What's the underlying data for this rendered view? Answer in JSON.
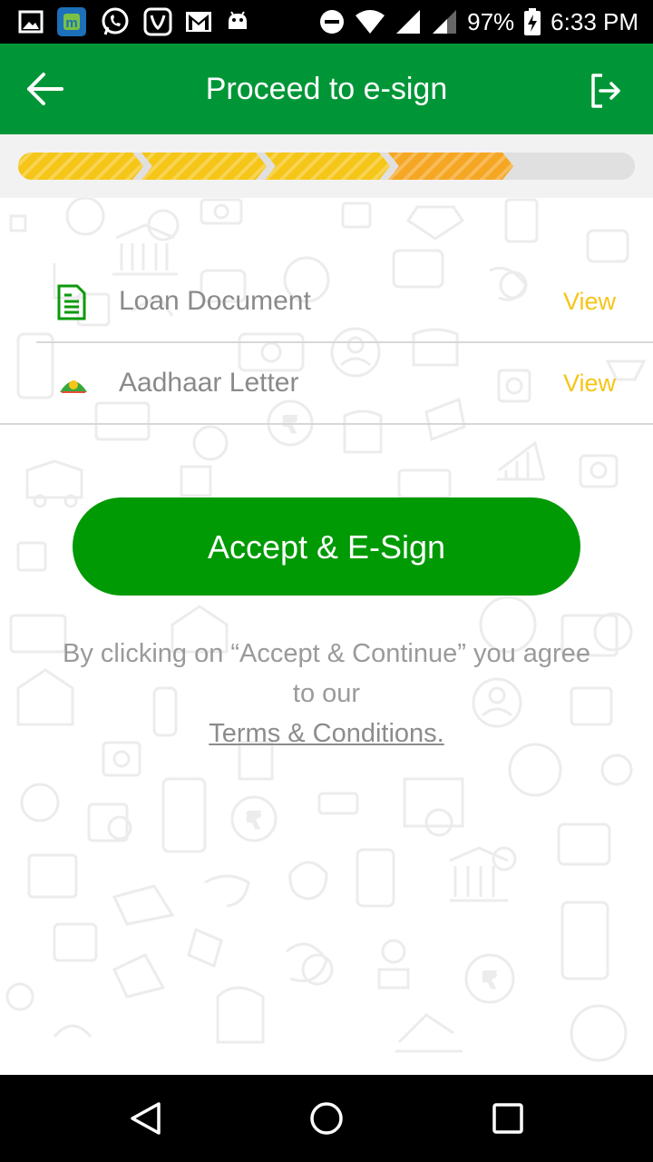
{
  "status_bar": {
    "battery": "97%",
    "time": "6:33 PM"
  },
  "app_bar": {
    "title": "Proceed to e-sign",
    "background": "#009637"
  },
  "progress": {
    "completed_steps": 4,
    "total_steps": 5
  },
  "documents": [
    {
      "label": "Loan Document",
      "action": "View",
      "icon": "document-icon"
    },
    {
      "label": "Aadhaar Letter",
      "action": "View",
      "icon": "aadhaar-emblem-icon"
    }
  ],
  "cta": {
    "label": "Accept & E-Sign",
    "color": "#009a05"
  },
  "consent": {
    "text": "By clicking on “Accept & Continue” you agree to our",
    "link": "Terms & Conditions."
  },
  "colors": {
    "link_yellow": "#f5c518",
    "progress_yellow": "#f5c518",
    "progress_orange": "#f5a623"
  }
}
